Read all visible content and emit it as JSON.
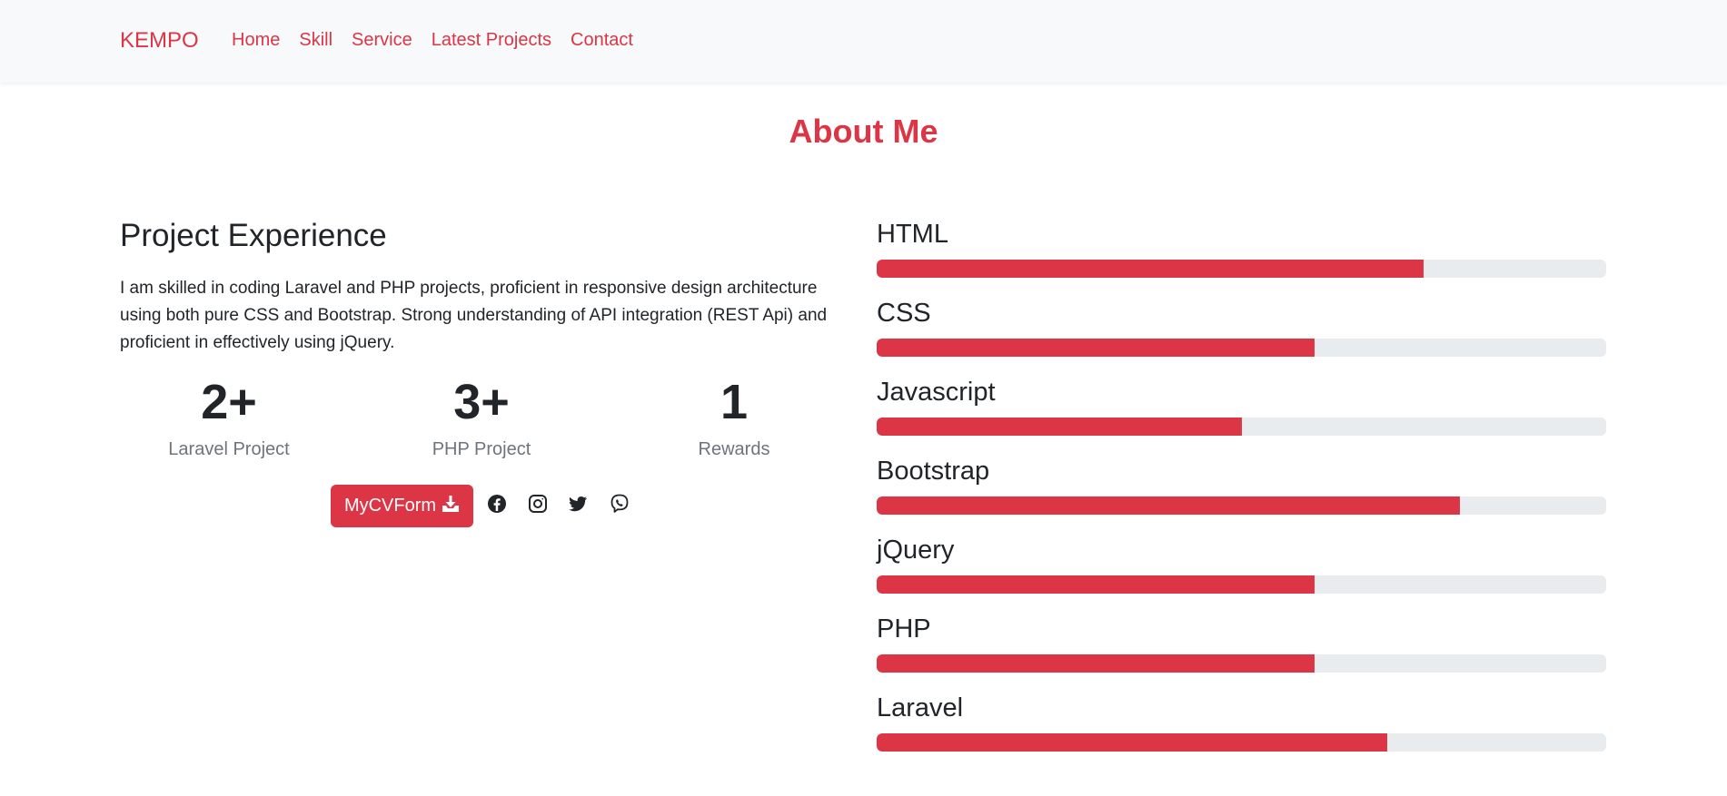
{
  "nav": {
    "brand": "KEMPO",
    "links": [
      "Home",
      "Skill",
      "Service",
      "Latest Projects",
      "Contact"
    ]
  },
  "about": {
    "title": "About Me",
    "experience_title": "Project Experience",
    "description": "I am skilled in coding Laravel and PHP projects, proficient in responsive design architecture using both pure CSS and Bootstrap. Strong understanding of API integration (REST Api) and proficient in effectively using jQuery.",
    "stats": [
      {
        "value": "2+",
        "label": "Laravel Project"
      },
      {
        "value": "3+",
        "label": "PHP Project"
      },
      {
        "value": "1",
        "label": "Rewards"
      }
    ],
    "cv_button_label": "MyCVForm",
    "social_icons": [
      "facebook-icon",
      "instagram-icon",
      "twitter-icon",
      "viber-icon"
    ]
  },
  "skills": [
    {
      "name": "HTML",
      "percent": 75
    },
    {
      "name": "CSS",
      "percent": 60
    },
    {
      "name": "Javascript",
      "percent": 50
    },
    {
      "name": "Bootstrap",
      "percent": 80
    },
    {
      "name": "jQuery",
      "percent": 60
    },
    {
      "name": "PHP",
      "percent": 60
    },
    {
      "name": "Laravel",
      "percent": 70
    }
  ],
  "colors": {
    "accent": "#dc3545",
    "track": "#e9ecef",
    "navbar_bg": "#f8f9fa",
    "text": "#212529",
    "muted": "#6c757d"
  }
}
